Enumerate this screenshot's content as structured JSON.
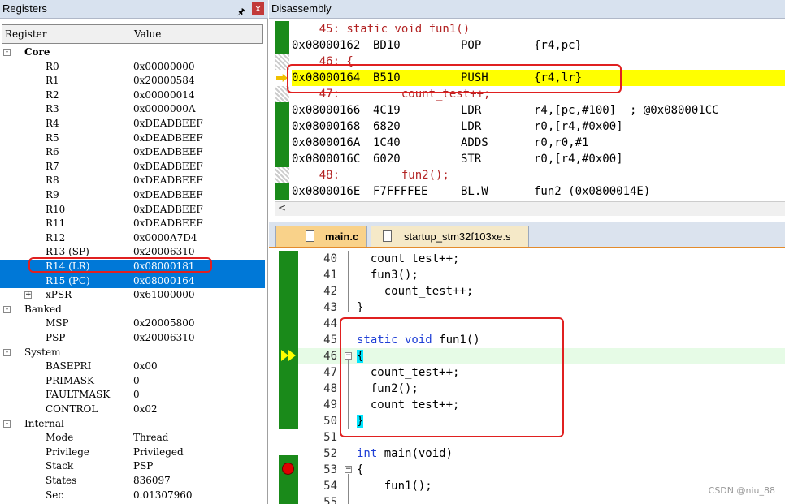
{
  "registers": {
    "title": "Registers",
    "pin_icon": "pin-icon",
    "close_label": "x",
    "col_register": "Register",
    "col_value": "Value",
    "rows": [
      {
        "name": "Core",
        "value": "",
        "expander": "-",
        "bold": true
      },
      {
        "name": "R0",
        "value": "0x00000000"
      },
      {
        "name": "R1",
        "value": "0x20000584"
      },
      {
        "name": "R2",
        "value": "0x00000014"
      },
      {
        "name": "R3",
        "value": "0x0000000A"
      },
      {
        "name": "R4",
        "value": "0xDEADBEEF"
      },
      {
        "name": "R5",
        "value": "0xDEADBEEF"
      },
      {
        "name": "R6",
        "value": "0xDEADBEEF"
      },
      {
        "name": "R7",
        "value": "0xDEADBEEF"
      },
      {
        "name": "R8",
        "value": "0xDEADBEEF"
      },
      {
        "name": "R9",
        "value": "0xDEADBEEF"
      },
      {
        "name": "R10",
        "value": "0xDEADBEEF"
      },
      {
        "name": "R11",
        "value": "0xDEADBEEF"
      },
      {
        "name": "R12",
        "value": "0x0000A7D4"
      },
      {
        "name": "R13 (SP)",
        "value": "0x20006310"
      },
      {
        "name": "R14 (LR)",
        "value": "0x08000181",
        "selected": true
      },
      {
        "name": "R15 (PC)",
        "value": "0x08000164",
        "selected": true
      },
      {
        "name": "xPSR",
        "value": "0x61000000",
        "expander": "+"
      },
      {
        "name": "Banked",
        "value": "",
        "expander": "-"
      },
      {
        "name": "MSP",
        "value": "0x20005800"
      },
      {
        "name": "PSP",
        "value": "0x20006310"
      },
      {
        "name": "System",
        "value": "",
        "expander": "-"
      },
      {
        "name": "BASEPRI",
        "value": "0x00"
      },
      {
        "name": "PRIMASK",
        "value": "0"
      },
      {
        "name": "FAULTMASK",
        "value": "0"
      },
      {
        "name": "CONTROL",
        "value": "0x02"
      },
      {
        "name": "Internal",
        "value": "",
        "expander": "-"
      },
      {
        "name": "Mode",
        "value": "Thread"
      },
      {
        "name": "Privilege",
        "value": "Privileged"
      },
      {
        "name": "Stack",
        "value": "PSP"
      },
      {
        "name": "States",
        "value": "836097"
      },
      {
        "name": "Sec",
        "value": "0.01307960"
      }
    ]
  },
  "disassembly": {
    "title": "Disassembly",
    "lines": [
      {
        "type": "src",
        "text": "    45: static void fun1()"
      },
      {
        "type": "asm",
        "addr": "0x08000162",
        "opcode": "BD10",
        "mnemonic": "POP",
        "operands": "{r4,pc}"
      },
      {
        "type": "src",
        "text": "    46: {"
      },
      {
        "type": "asm",
        "addr": "0x08000164",
        "opcode": "B510",
        "mnemonic": "PUSH",
        "operands": "{r4,lr}",
        "current": true
      },
      {
        "type": "src",
        "text": "    47:         count_test++;"
      },
      {
        "type": "asm",
        "addr": "0x08000166",
        "opcode": "4C19",
        "mnemonic": "LDR",
        "operands": "r4,[pc,#100]  ; @0x080001CC"
      },
      {
        "type": "asm",
        "addr": "0x08000168",
        "opcode": "6820",
        "mnemonic": "LDR",
        "operands": "r0,[r4,#0x00]"
      },
      {
        "type": "asm",
        "addr": "0x0800016A",
        "opcode": "1C40",
        "mnemonic": "ADDS",
        "operands": "r0,r0,#1"
      },
      {
        "type": "asm",
        "addr": "0x0800016C",
        "opcode": "6020",
        "mnemonic": "STR",
        "operands": "r0,[r4,#0x00]"
      },
      {
        "type": "src",
        "text": "    48:         fun2();"
      },
      {
        "type": "asm",
        "addr": "0x0800016E",
        "opcode": "F7FFFFEE",
        "mnemonic": "BL.W",
        "operands": "fun2 (0x0800014E)"
      }
    ],
    "scroll_left": "<"
  },
  "tabs": [
    {
      "label": "main.c",
      "active": true
    },
    {
      "label": "startup_stm32f103xe.s",
      "active": false
    }
  ],
  "editor": {
    "lines": [
      {
        "n": "40",
        "code": "  count_test++;"
      },
      {
        "n": "41",
        "code": "  fun3();"
      },
      {
        "n": "42",
        "code": "    count_test++;"
      },
      {
        "n": "43",
        "code": "}"
      },
      {
        "n": "44",
        "code": ""
      },
      {
        "n": "45",
        "kw": "static void",
        "code": " fun1()"
      },
      {
        "n": "46",
        "code": "{",
        "brace": true,
        "highlight": true
      },
      {
        "n": "47",
        "code": "  count_test++;"
      },
      {
        "n": "48",
        "code": "  fun2();"
      },
      {
        "n": "49",
        "code": "  count_test++;"
      },
      {
        "n": "50",
        "code": "}",
        "brace": true
      },
      {
        "n": "51",
        "code": ""
      },
      {
        "n": "52",
        "kw": "int",
        "code": " main(void)"
      },
      {
        "n": "53",
        "code": "{"
      },
      {
        "n": "54",
        "code": "    fun1();"
      },
      {
        "n": "55",
        "code": ""
      }
    ]
  },
  "watermark": "CSDN @niu_88",
  "colors": {
    "highlight_box": "#e02020",
    "current_line": "#ffff00",
    "selection": "#0078d7",
    "gutter_green": "#1a8a1a"
  }
}
